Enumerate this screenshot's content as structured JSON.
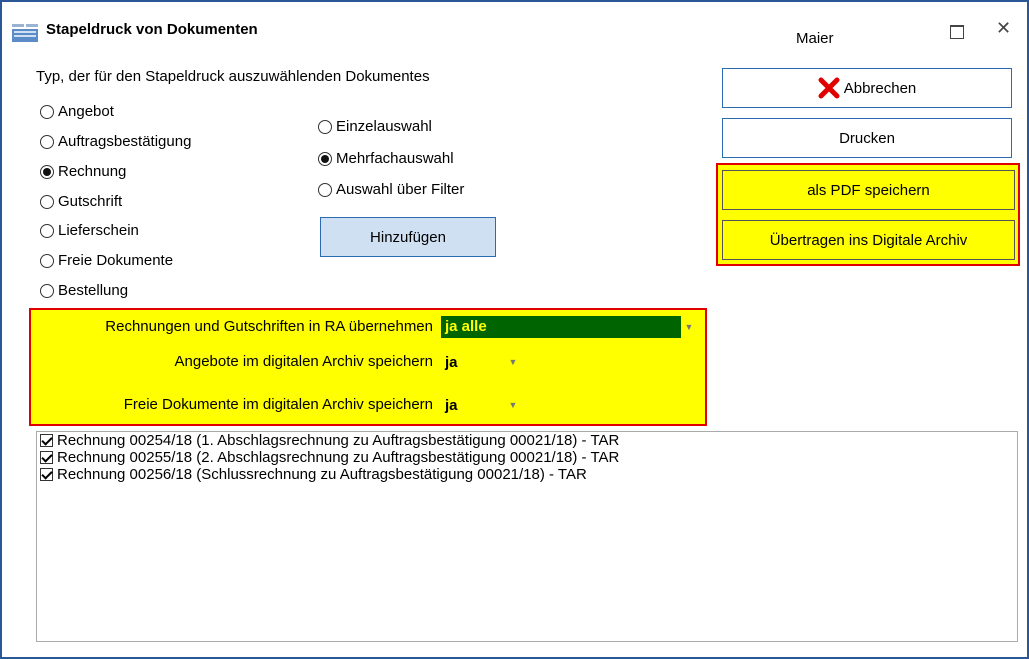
{
  "window": {
    "title": "Stapeldruck von Dokumenten",
    "user": "Maier",
    "border_color": "#2b5797"
  },
  "doc_type": {
    "heading": "Typ, der für den Stapeldruck auszuwählenden Dokumentes",
    "options": [
      "Angebot",
      "Auftragsbestätigung",
      "Rechnung",
      "Gutschrift",
      "Lieferschein",
      "Freie Dokumente",
      "Bestellung"
    ],
    "selected": "Rechnung"
  },
  "selection_mode": {
    "options": [
      "Einzelauswahl",
      "Mehrfachauswahl",
      "Auswahl über Filter"
    ],
    "selected": "Mehrfachauswahl"
  },
  "buttons": {
    "add": "Hinzufügen",
    "cancel": "Abbrechen",
    "print": "Drucken",
    "save_pdf": "als PDF speichern",
    "archive": "Übertragen ins Digitale Archiv"
  },
  "settings": {
    "rechnungen_label": "Rechnungen und Gutschriften in RA übernehmen",
    "rechnungen_value": "ja alle",
    "angebote_label": "Angebote im digitalen Archiv speichern",
    "angebote_value": "ja",
    "freie_label": "Freie Dokumente im digitalen Archiv speichern",
    "freie_value": "ja",
    "highlight_color": "#ffff00",
    "selected_combo_color": "#006400",
    "selected_combo_text_color": "#ffff00"
  },
  "documents": [
    {
      "checked": true,
      "text": "Rechnung 00254/18 (1. Abschlagsrechnung zu Auftragsbestätigung 00021/18) - TAR"
    },
    {
      "checked": true,
      "text": "Rechnung 00255/18 (2. Abschlagsrechnung zu Auftragsbestätigung 00021/18) - TAR"
    },
    {
      "checked": true,
      "text": "Rechnung 00256/18 (Schlussrechnung zu Auftragsbestätigung 00021/18) - TAR"
    }
  ],
  "icons": {
    "app": "grid-app-icon",
    "cancel": "red-x-icon",
    "maximize": "maximize-icon",
    "close": "close-icon",
    "dropdown": "chevron-down-icon"
  }
}
